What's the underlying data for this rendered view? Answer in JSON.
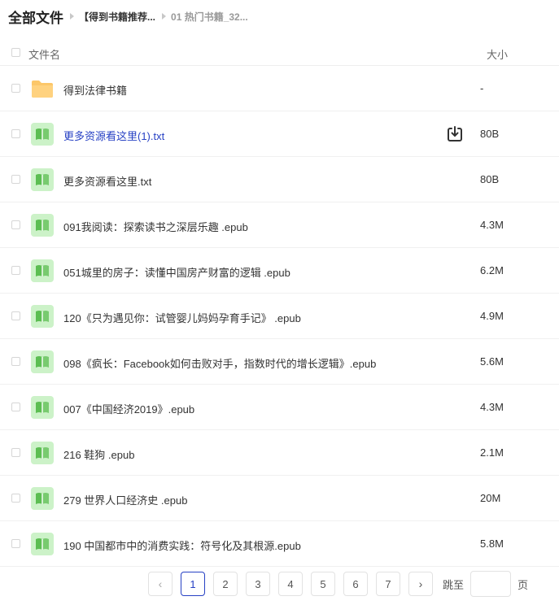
{
  "breadcrumb": {
    "root": "全部文件",
    "middle": "【得到书籍推荐...",
    "current": "01 热门书籍_32..."
  },
  "table": {
    "col_name": "文件名",
    "col_size": "大小"
  },
  "files": [
    {
      "name": "得到法律书籍",
      "size": "-",
      "type": "folder-icon"
    },
    {
      "name": "更多资源看这里(1).txt",
      "size": "80B",
      "type": "document-icon",
      "highlighted": true
    },
    {
      "name": "更多资源看这里.txt",
      "size": "80B",
      "type": "document-icon"
    },
    {
      "name": "091我阅读：探索读书之深层乐趣 .epub",
      "size": "4.3M",
      "type": "document-icon"
    },
    {
      "name": "051城里的房子：读懂中国房产财富的逻辑 .epub",
      "size": "6.2M",
      "type": "document-icon"
    },
    {
      "name": "120《只为遇见你：试管婴儿妈妈孕育手记》 .epub",
      "size": "4.9M",
      "type": "document-icon"
    },
    {
      "name": "098《疯长：Facebook如何击败对手，指数时代的增长逻辑》.epub",
      "size": "5.6M",
      "type": "document-icon"
    },
    {
      "name": "007《中国经济2019》.epub",
      "size": "4.3M",
      "type": "document-icon"
    },
    {
      "name": "216 鞋狗 .epub",
      "size": "2.1M",
      "type": "document-icon"
    },
    {
      "name": "279 世界人口经济史 .epub",
      "size": "20M",
      "type": "document-icon"
    },
    {
      "name": "190 中国都市中的消费实践：符号化及其根源.epub",
      "size": "5.8M",
      "type": "document-icon"
    }
  ],
  "pagination": {
    "prev": "‹",
    "next": "›",
    "pages": [
      "1",
      "2",
      "3",
      "4",
      "5",
      "6",
      "7"
    ],
    "current": "1",
    "jump_label": "跳至",
    "jump_value": "",
    "page_suffix": "页"
  },
  "colors": {
    "accent": "#2741c4",
    "folder": "#fcc769",
    "document_bg": "#ccf2c8",
    "document_fg": "#5cbe52"
  }
}
